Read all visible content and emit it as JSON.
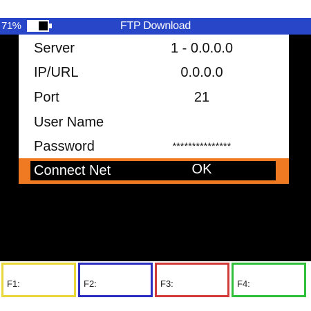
{
  "status": {
    "battery_percent": "71%",
    "battery_level": 0.55,
    "title": "FTP Download"
  },
  "form": {
    "rows": [
      {
        "label": "Server",
        "value": "1 - 0.0.0.0"
      },
      {
        "label": "IP/URL",
        "value": "0.0.0.0"
      },
      {
        "label": "Port",
        "value": "21"
      },
      {
        "label": "User Name",
        "value": ""
      },
      {
        "label": "Password",
        "value": "***************"
      }
    ],
    "action": {
      "label": "Connect Net",
      "value": "OK"
    }
  },
  "function_keys": [
    {
      "label": "F1:",
      "color": "#e8d83a"
    },
    {
      "label": "F2:",
      "color": "#2b2fbf"
    },
    {
      "label": "F3:",
      "color": "#d23a3a"
    },
    {
      "label": "F4:",
      "color": "#2fbf3a"
    }
  ],
  "colors": {
    "titlebar": "#2746c8",
    "selection": "#f07a22",
    "background": "#000000"
  }
}
